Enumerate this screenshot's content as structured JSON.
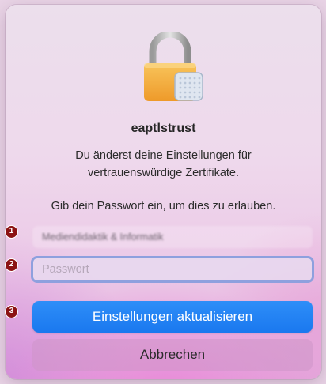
{
  "dialog": {
    "icon": "padlock-certificate-icon",
    "title": "eaptlstrust",
    "message_line1": "Du änderst deine Einstellungen für",
    "message_line2": "vertrauenswürdige Zertifikate.",
    "hint": "Gib dein Passwort ein, um dies zu erlauben."
  },
  "fields": {
    "username_value": "Mediendidaktik & Informatik",
    "password_placeholder": "Passwort",
    "password_value": ""
  },
  "buttons": {
    "update_label": "Einstellungen aktualisieren",
    "cancel_label": "Abbrechen"
  },
  "annotations": {
    "badge1": "1",
    "badge2": "2",
    "badge3": "3",
    "badge_color": "#8c1414"
  },
  "colors": {
    "accent": "#1a78ef",
    "focus_ring": "#8ea0de",
    "lock_body": "#f3a83b"
  }
}
